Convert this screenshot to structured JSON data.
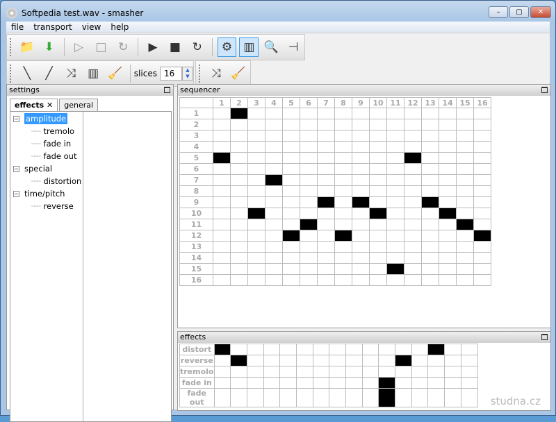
{
  "window": {
    "title": "Softpedia test.wav - smasher",
    "minimize": "–",
    "maximize": "▢",
    "close": "✕"
  },
  "menu": [
    "file",
    "transport",
    "view",
    "help"
  ],
  "toolbar2": {
    "slices_label": "slices",
    "slices_value": "16"
  },
  "settings": {
    "title": "settings",
    "tabs": [
      "effects",
      "general"
    ],
    "tab_close": "✕",
    "tree": [
      {
        "label": "amplitude",
        "children": [
          "tremolo",
          "fade in",
          "fade out"
        ]
      },
      {
        "label": "special",
        "children": [
          "distortion"
        ]
      },
      {
        "label": "time/pitch",
        "children": [
          "reverse"
        ]
      }
    ]
  },
  "sequencer": {
    "title": "sequencer",
    "cols": [
      "1",
      "2",
      "3",
      "4",
      "5",
      "6",
      "7",
      "8",
      "9",
      "10",
      "11",
      "12",
      "13",
      "14",
      "15",
      "16"
    ],
    "rows": [
      "1",
      "2",
      "3",
      "4",
      "5",
      "6",
      "7",
      "8",
      "9",
      "10",
      "11",
      "12",
      "13",
      "14",
      "15",
      "16"
    ],
    "active": [
      [
        1,
        2
      ],
      [
        5,
        1
      ],
      [
        5,
        12
      ],
      [
        7,
        4
      ],
      [
        9,
        7
      ],
      [
        9,
        9
      ],
      [
        9,
        13
      ],
      [
        10,
        3
      ],
      [
        10,
        10
      ],
      [
        10,
        14
      ],
      [
        11,
        6
      ],
      [
        11,
        15
      ],
      [
        12,
        5
      ],
      [
        12,
        8
      ],
      [
        12,
        16
      ],
      [
        15,
        11
      ]
    ]
  },
  "effects": {
    "title": "effects",
    "rows": [
      "distort",
      "reverse",
      "tremolo",
      "fade in",
      "fade out"
    ],
    "active": [
      [
        1,
        1
      ],
      [
        1,
        14
      ],
      [
        2,
        2
      ],
      [
        2,
        12
      ],
      [
        4,
        11
      ],
      [
        5,
        11
      ]
    ]
  },
  "watermark": "studna.cz"
}
